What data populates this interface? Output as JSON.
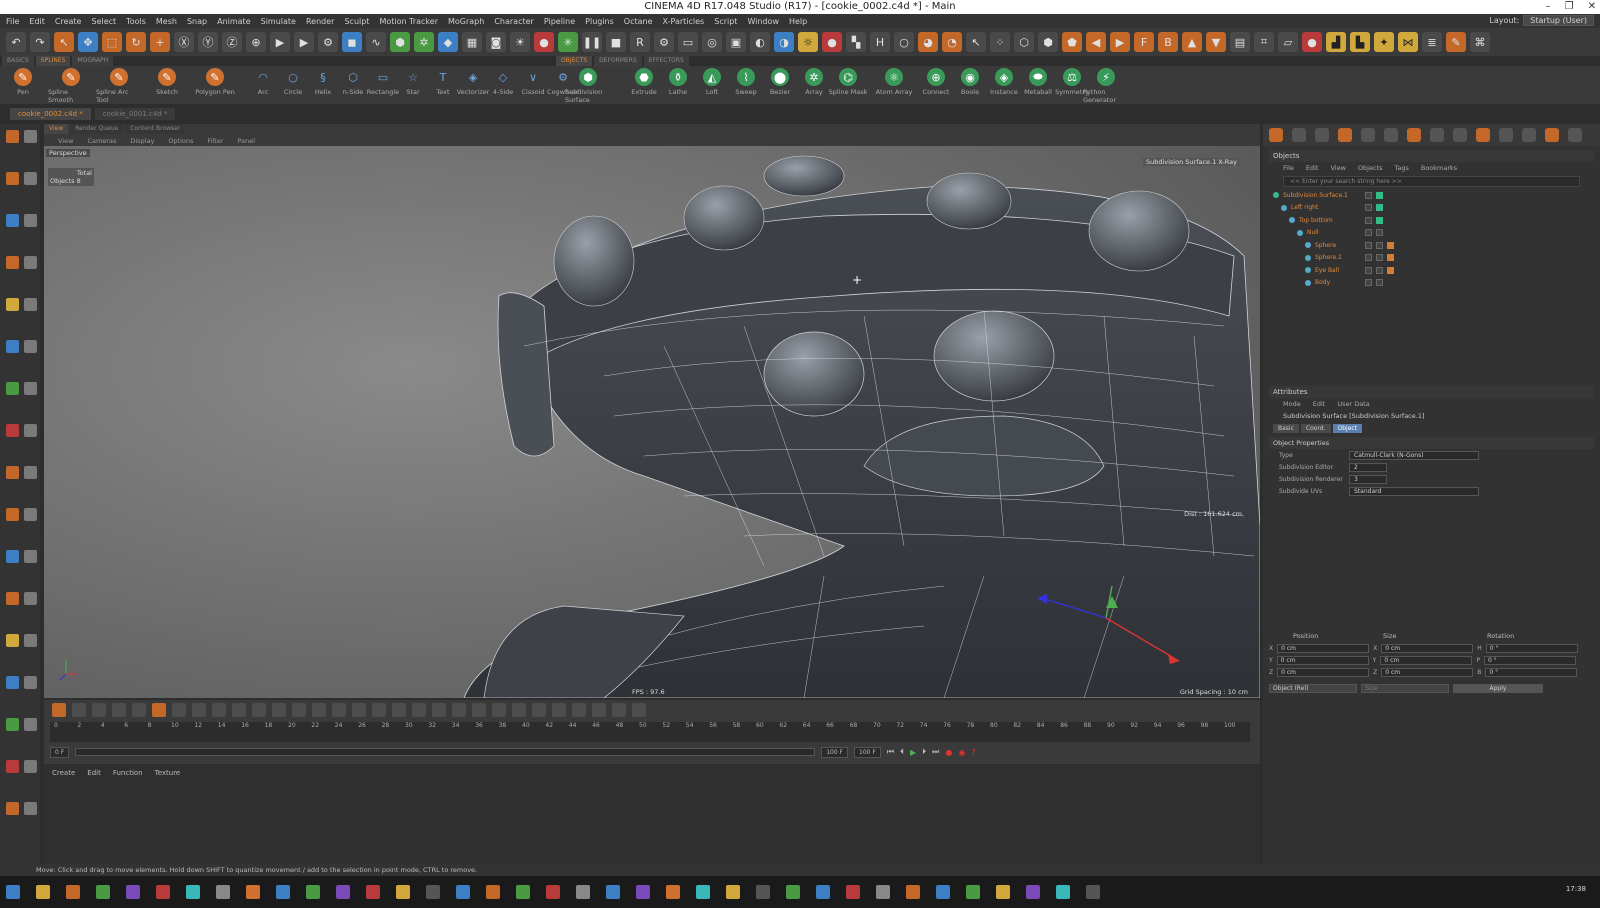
{
  "app": {
    "title": "CINEMA 4D R17.048 Studio (R17) - [cookie_0002.c4d *] - Main"
  },
  "menu": [
    "File",
    "Edit",
    "Create",
    "Select",
    "Tools",
    "Mesh",
    "Snap",
    "Animate",
    "Simulate",
    "Render",
    "Sculpt",
    "Motion Tracker",
    "MoGraph",
    "Character",
    "Pipeline",
    "Plugins",
    "Octane",
    "X-Particles",
    "Script",
    "Window",
    "Help"
  ],
  "layout": {
    "label": "Layout:",
    "value": "Startup (User)"
  },
  "palette_tabs": [
    "BASICS",
    "SPLINES",
    "MOGRAPH",
    "OBJECTS",
    "DEFORMERS",
    "EFFECTORS"
  ],
  "spline_tools": [
    "Pen",
    "Spline Smooth",
    "Spline Arc Tool",
    "Sketch",
    "Polygon Pen",
    "Arc",
    "Circle",
    "Helix",
    "n-Side",
    "Rectangle",
    "Star",
    "Text",
    "Vectorizer",
    "4-Side",
    "Cissoid",
    "Cogwheel"
  ],
  "object_tools": [
    "Subdivision Surface",
    "Extrude",
    "Lathe",
    "Loft",
    "Sweep",
    "Bezier",
    "Array",
    "Spline Mask",
    "Atom Array",
    "Connect",
    "Boole",
    "Instance",
    "Metaball",
    "Symmetry",
    "Python Generator"
  ],
  "documents": [
    "cookie_0002.c4d *",
    "cookie_0001.c4d *"
  ],
  "viewport": {
    "tabs": [
      "View",
      "Render Queue",
      "Content Browser"
    ],
    "menu": [
      "View",
      "Cameras",
      "Display",
      "Options",
      "Filter",
      "Panel"
    ],
    "camera": "Perspective",
    "stats_total": "Total",
    "stats_objects": "Objects  8",
    "xray": "Subdivision Surface.1 X-Ray",
    "dist": "Dist : 161.624 cm",
    "fps": "FPS : 97.6",
    "grid": "Grid Spacing : 10 cm"
  },
  "timeline": {
    "ticks": [
      "0",
      "2",
      "4",
      "6",
      "8",
      "10",
      "12",
      "14",
      "16",
      "18",
      "20",
      "22",
      "24",
      "26",
      "28",
      "30",
      "32",
      "34",
      "36",
      "38",
      "40",
      "42",
      "44",
      "46",
      "48",
      "50",
      "52",
      "54",
      "56",
      "58",
      "60",
      "62",
      "64",
      "66",
      "68",
      "70",
      "72",
      "74",
      "76",
      "78",
      "80",
      "82",
      "84",
      "86",
      "88",
      "90",
      "92",
      "94",
      "96",
      "98",
      "100"
    ],
    "start": "0 F",
    "end_a": "100 F",
    "end_b": "100 F",
    "current": "0 F"
  },
  "material_menu": [
    "Create",
    "Edit",
    "Function",
    "Texture"
  ],
  "objects_panel": {
    "title": "Objects",
    "menu": [
      "File",
      "Edit",
      "View",
      "Objects",
      "Tags",
      "Bookmarks"
    ],
    "search_placeholder": "<< Enter your search string here >>",
    "items": [
      {
        "name": "Subdivision Surface.1",
        "indent": 0
      },
      {
        "name": "Left right",
        "indent": 1
      },
      {
        "name": "Top bottom",
        "indent": 2
      },
      {
        "name": "Null",
        "indent": 3
      },
      {
        "name": "Sphere",
        "indent": 4
      },
      {
        "name": "Sphere.1",
        "indent": 4
      },
      {
        "name": "Eye Ball",
        "indent": 4
      },
      {
        "name": "Body",
        "indent": 4
      }
    ]
  },
  "attributes": {
    "title": "Attributes",
    "menu": [
      "Mode",
      "Edit",
      "User Data"
    ],
    "object_name": "Subdivision Surface [Subdivision Surface.1]",
    "tabs": [
      "Basic",
      "Coord.",
      "Object"
    ],
    "section": "Object Properties",
    "props": [
      {
        "label": "Type",
        "value": "Catmull-Clark (N-Gons)"
      },
      {
        "label": "Subdivision Editor",
        "value": "2"
      },
      {
        "label": "Subdivision Renderer",
        "value": "3"
      },
      {
        "label": "Subdivide UVs",
        "value": "Standard"
      }
    ]
  },
  "coords": {
    "headers": [
      "Position",
      "Size",
      "Rotation"
    ],
    "rows": [
      {
        "axis": "X",
        "pos": "0 cm",
        "saxis": "X",
        "size": "0 cm",
        "raxis": "H",
        "rot": "0 °"
      },
      {
        "axis": "Y",
        "pos": "0 cm",
        "saxis": "Y",
        "size": "0 cm",
        "raxis": "P",
        "rot": "0 °"
      },
      {
        "axis": "Z",
        "pos": "0 cm",
        "saxis": "Z",
        "size": "0 cm",
        "raxis": "B",
        "rot": "0 °"
      }
    ],
    "mode": "Object (Rel)",
    "size_mode": "Size",
    "apply": "Apply"
  },
  "status": "Move: Click and drag to move elements. Hold down SHIFT to quantize movement / add to the selection in point mode, CTRL to remove.",
  "clock": "17:38"
}
